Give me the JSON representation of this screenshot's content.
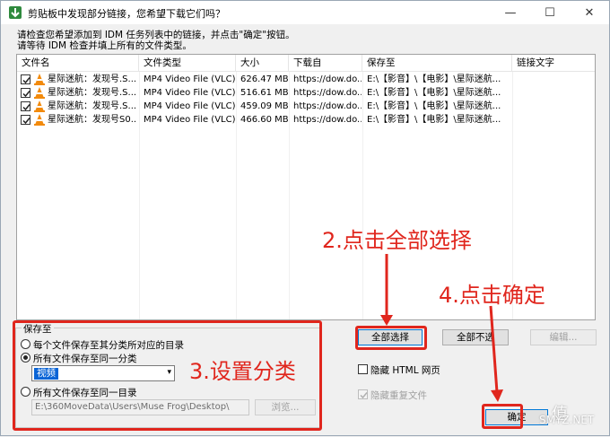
{
  "window": {
    "title": "剪贴板中发现部分链接，您希望下载它们吗？",
    "controls": {
      "minimize": "—",
      "maximize": "☐",
      "close": "✕"
    }
  },
  "instructions": {
    "line1": "请检查您希望添加到 IDM 任务列表中的链接，并点击\"确定\"按钮。",
    "line2": "请等待 IDM 检查并填上所有的文件类型。"
  },
  "list": {
    "columns": [
      "文件名",
      "文件类型",
      "大小",
      "下载自",
      "保存至",
      "链接文字"
    ],
    "rows": [
      {
        "name": "星际迷航：发现号.S...",
        "type": "MP4 Video File (VLC)",
        "size": "626.47 MB",
        "from": "https://dow.do...",
        "save": "E:\\【影音】\\【电影】\\星际迷航...",
        "link": ""
      },
      {
        "name": "星际迷航：发现号.S...",
        "type": "MP4 Video File (VLC)",
        "size": "516.61 MB",
        "from": "https://dow.do...",
        "save": "E:\\【影音】\\【电影】\\星际迷航...",
        "link": ""
      },
      {
        "name": "星际迷航：发现号.S...",
        "type": "MP4 Video File (VLC)",
        "size": "459.09 MB",
        "from": "https://dow.do...",
        "save": "E:\\【影音】\\【电影】\\星际迷航...",
        "link": ""
      },
      {
        "name": "星际迷航：发现号S0...",
        "type": "MP4 Video File (VLC)",
        "size": "466.60 MB",
        "from": "https://dow.do...",
        "save": "E:\\【影音】\\【电影】\\星际迷航...",
        "link": ""
      }
    ]
  },
  "save_group": {
    "title": "保存至",
    "option1": "每个文件保存至其分类所对应的目录",
    "option2": "所有文件保存至同一分类",
    "option3": "所有文件保存至同一目录",
    "category_value": "视频",
    "path_value": "E:\\360MoveData\\Users\\Muse Frog\\Desktop\\",
    "browse_label": "浏览..."
  },
  "buttons": {
    "select_all": "全部选择",
    "deselect_all": "全部不选",
    "edit": "编辑...",
    "ok": "确定"
  },
  "checkboxes": {
    "hide_html": "隐藏 HTML 网页",
    "hide_dup": "隐藏重复文件"
  },
  "annotations": {
    "step2": "2.点击全部选择",
    "step3": "3.设置分类",
    "step4": "4.点击确定",
    "color": "#e0261d"
  },
  "watermark": {
    "text1": "值",
    "text2": "SMYZ.NET"
  }
}
